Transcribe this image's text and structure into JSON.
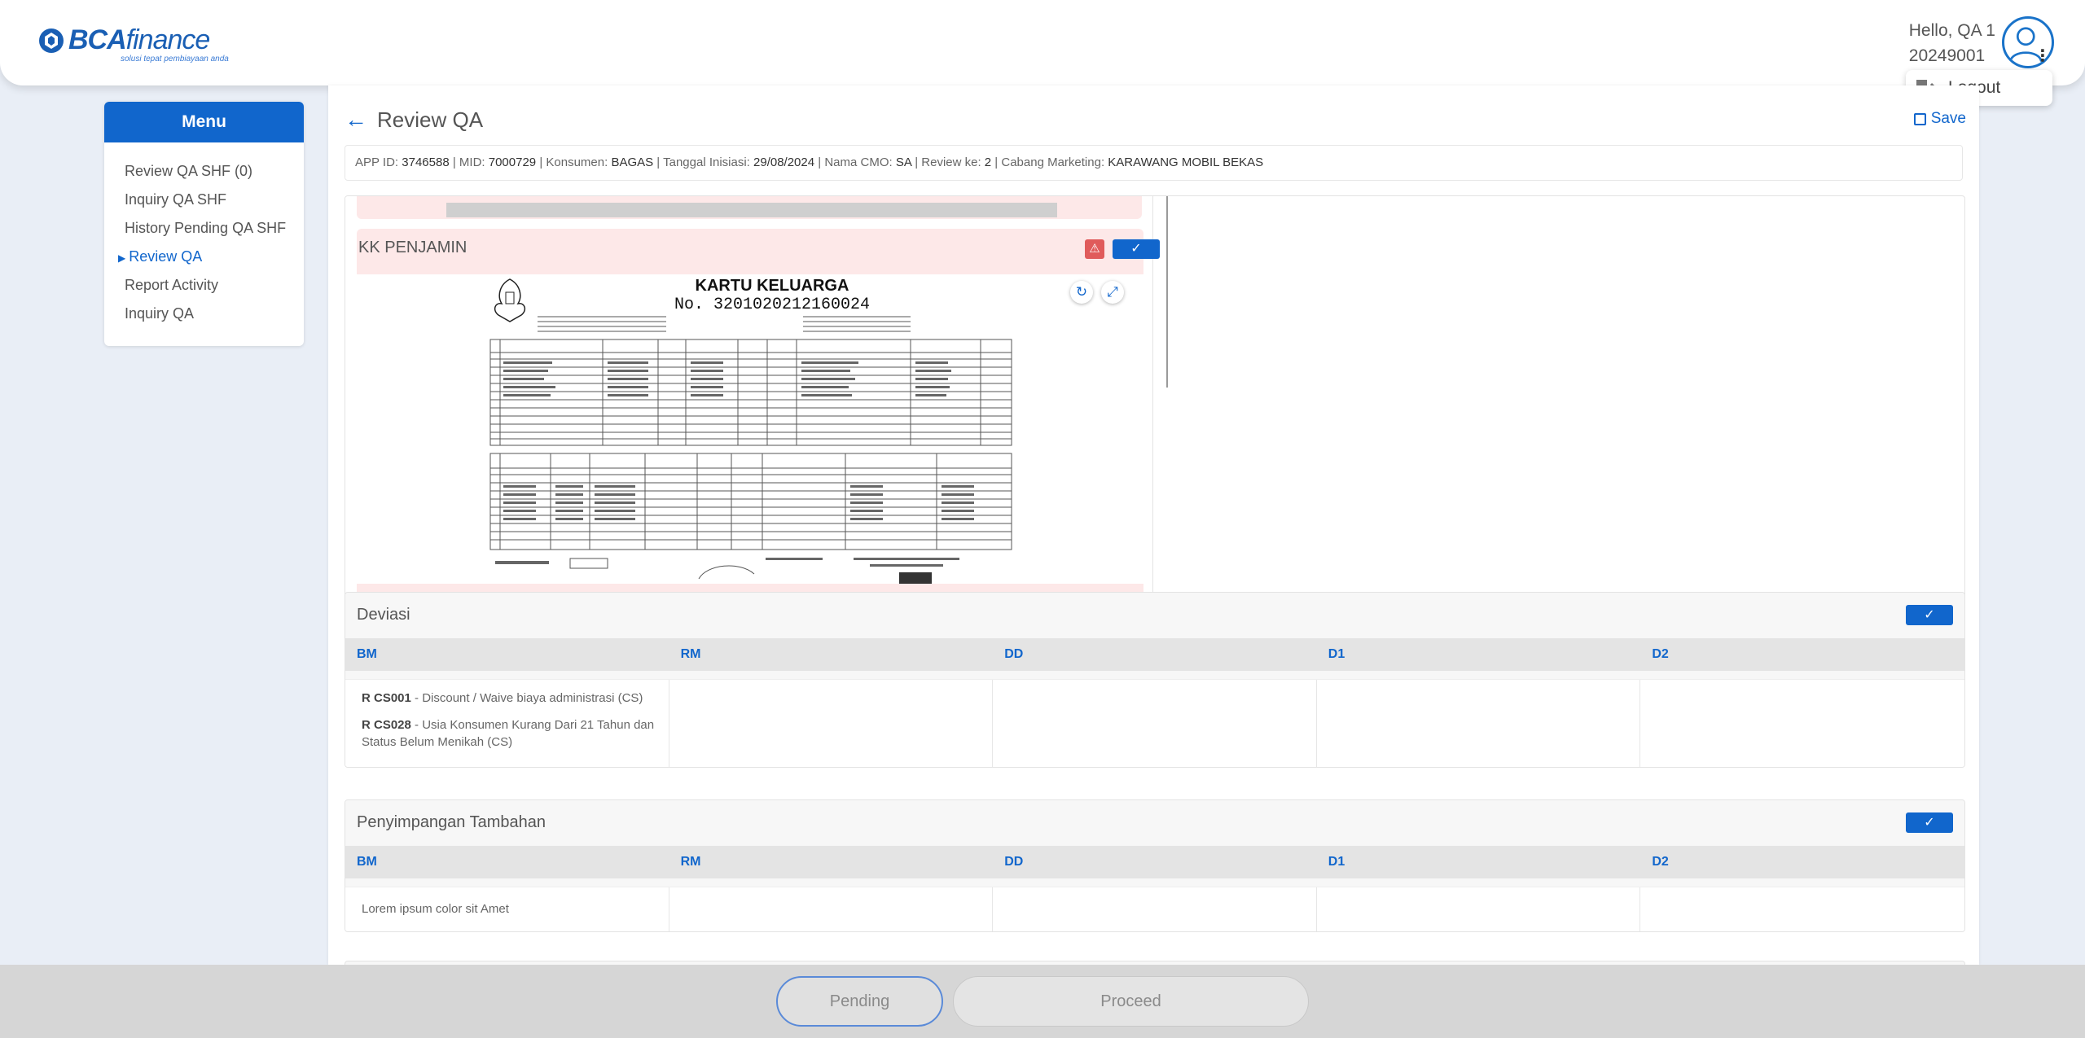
{
  "header": {
    "logo_text_bold": "BCA",
    "logo_text_rest": "finance",
    "logo_tagline": "solusi tepat pembiayaan anda",
    "greeting": "Hello, QA 1",
    "user_id": "20249001",
    "logout_label": "Logout"
  },
  "sidebar": {
    "title": "Menu",
    "items": [
      {
        "label": "Review QA SHF (0)"
      },
      {
        "label": "Inquiry QA SHF"
      },
      {
        "label": "History Pending QA SHF"
      },
      {
        "label": "Review QA",
        "active": true
      },
      {
        "label": "Report Activity"
      },
      {
        "label": "Inquiry QA"
      }
    ]
  },
  "page": {
    "title": "Review QA",
    "save_label": "Save"
  },
  "info_bar": {
    "app_id_label": "APP ID:",
    "app_id": "3746588",
    "mid_label": "MID:",
    "mid": "7000729",
    "konsumen_label": "Konsumen:",
    "konsumen": "BAGAS",
    "tanggal_label": "Tanggal Inisiasi:",
    "tanggal": "29/08/2024",
    "cmo_label": "Nama CMO:",
    "cmo": "SA",
    "review_label": "Review ke:",
    "review": "2",
    "cabang_label": "Cabang Marketing:",
    "cabang": "KARAWANG MOBIL BEKAS"
  },
  "document": {
    "title": "KK PENJAMIN",
    "doc_heading": "KARTU KELUARGA",
    "doc_number": "No. 3201020212160024",
    "check_icon": "check-icon",
    "warn_icon": "alert-triangle-icon"
  },
  "deviasi": {
    "title": "Deviasi",
    "columns": [
      "BM",
      "RM",
      "DD",
      "D1",
      "D2"
    ],
    "bm_items": [
      {
        "code": "R CS001",
        "text": " - Discount / Waive biaya administrasi (CS)"
      },
      {
        "code": "R CS028",
        "text": " - Usia Konsumen Kurang Dari 21 Tahun dan Status Belum Menikah (CS)"
      }
    ]
  },
  "penyimpangan": {
    "title": "Penyimpangan Tambahan",
    "columns": [
      "BM",
      "RM",
      "DD",
      "D1",
      "D2"
    ],
    "bm_text": "Lorem ipsum color sit Amet"
  },
  "footer": {
    "pending_label": "Pending",
    "proceed_label": "Proceed"
  },
  "colors": {
    "primary": "#1166cc",
    "danger": "#e05b5b",
    "doc_card_bg": "#fde8e8"
  }
}
